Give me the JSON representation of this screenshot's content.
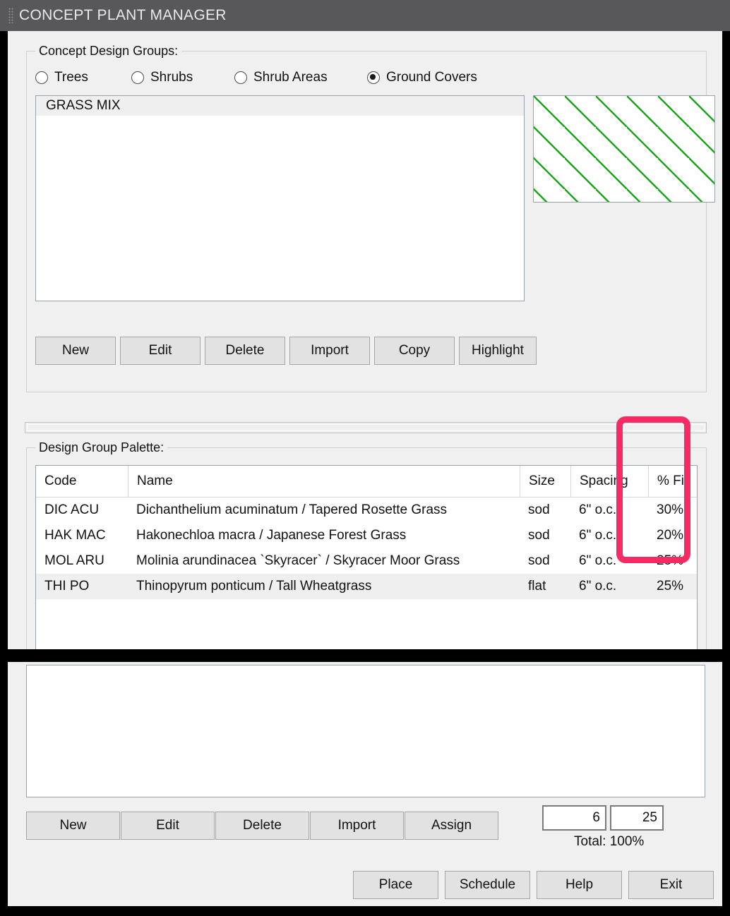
{
  "window": {
    "title": "CONCEPT PLANT MANAGER",
    "grip_icon": "drag-grip-icon",
    "titlebar_color": "#58585a"
  },
  "groups_section": {
    "legend": "Concept Design Groups:",
    "radios": [
      {
        "label": "Trees",
        "selected": false
      },
      {
        "label": "Shrubs",
        "selected": false
      },
      {
        "label": "Shrub Areas",
        "selected": false
      },
      {
        "label": "Ground Covers",
        "selected": true
      }
    ],
    "list_items": [
      {
        "label": "GRASS MIX",
        "selected": true
      }
    ],
    "preview": {
      "name": "hatch-preview",
      "pattern": "diagonal-hatch",
      "line_color": "#19a319",
      "background": "#ffffff"
    },
    "buttons": [
      "New",
      "Edit",
      "Delete",
      "Import",
      "Copy",
      "Highlight"
    ]
  },
  "palette_section": {
    "legend": "Design Group Palette:",
    "columns": [
      "Code",
      "Name",
      "Size",
      "Spacing",
      "% Fill"
    ],
    "rows": [
      {
        "code": "DIC ACU",
        "name": "Dichanthelium acuminatum / Tapered Rosette Grass",
        "size": "sod",
        "spacing": "6\" o.c.",
        "fill": "30%",
        "selected": false
      },
      {
        "code": "HAK MAC",
        "name": "Hakonechloa macra / Japanese Forest Grass",
        "size": "sod",
        "spacing": "6\" o.c.",
        "fill": "20%",
        "selected": false
      },
      {
        "code": "MOL ARU",
        "name": "Molinia arundinacea `Skyracer` / Skyracer Moor Grass",
        "size": "sod",
        "spacing": "6\" o.c.",
        "fill": "25%",
        "selected": false
      },
      {
        "code": "THI  PO",
        "name": "Thinopyrum  ponticum / Tall Wheatgrass",
        "size": "flat",
        "spacing": "6\" o.c.",
        "fill": "25%",
        "selected": true
      }
    ]
  },
  "lower_section": {
    "buttons": [
      "New",
      "Edit",
      "Delete",
      "Import",
      "Assign"
    ],
    "spacing_value": "6",
    "fill_value": "25",
    "total_label": "Total: 100%"
  },
  "footer": {
    "buttons": [
      "Place",
      "Schedule",
      "Help",
      "Exit"
    ]
  },
  "annotation": {
    "highlight_color": "#f72b64",
    "target": "% Fill column"
  }
}
